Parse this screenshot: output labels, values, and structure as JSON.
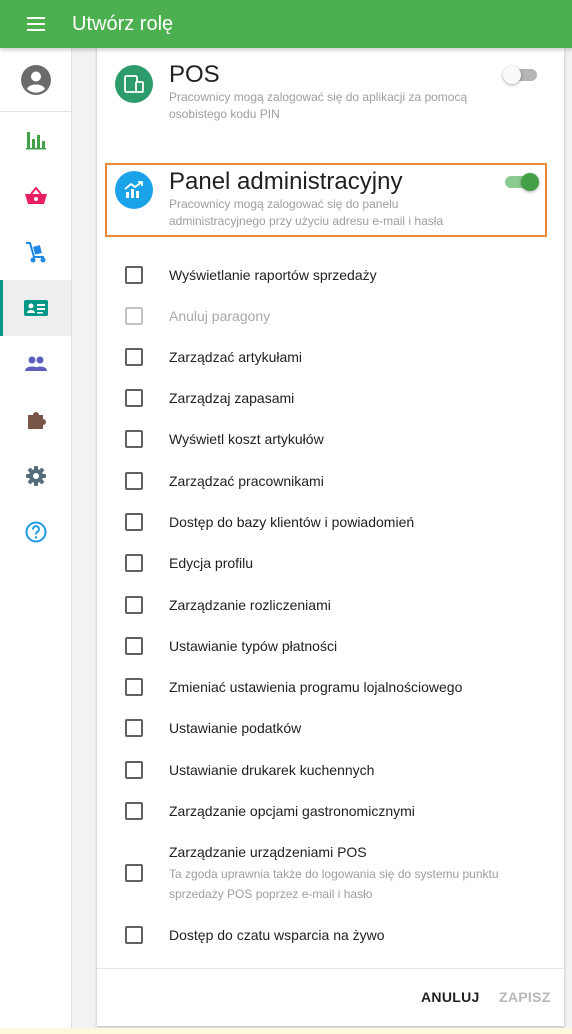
{
  "app": {
    "title": "Utwórz rolę"
  },
  "icons": {
    "menu": "menu-icon",
    "avatar": "account-circle-icon",
    "sidebar": [
      "bar-chart-icon",
      "basket-icon",
      "hand-truck-icon",
      "id-card-icon",
      "people-icon",
      "puzzle-icon",
      "gear-icon",
      "help-circle-icon"
    ]
  },
  "colors": {
    "accent": "#4caf50",
    "pos_icon": "#2e9c6a",
    "admin_icon": "#1aa3e8",
    "sidebar_active_indicator": "#009688",
    "highlight_border": "#e88a3a"
  },
  "pos": {
    "title": "POS",
    "description": "Pracownicy mogą zalogować się do aplikacji za pomocą osobistego kodu PIN",
    "enabled": false
  },
  "admin": {
    "title": "Panel administracyjny",
    "description": "Pracownicy mogą zalogować się do panelu administracyjnego przy użyciu adresu e-mail i hasła",
    "enabled": true
  },
  "permissions": [
    {
      "label": "Wyświetlanie raportów sprzedaży",
      "checked": false,
      "disabled": false
    },
    {
      "label": "Anuluj paragony",
      "checked": false,
      "disabled": true
    },
    {
      "label": "Zarządzać artykułami",
      "checked": false,
      "disabled": false
    },
    {
      "label": "Zarządzaj zapasami",
      "checked": false,
      "disabled": false
    },
    {
      "label": "Wyświetl koszt artykułów",
      "checked": false,
      "disabled": false
    },
    {
      "label": "Zarządzać pracownikami",
      "checked": false,
      "disabled": false
    },
    {
      "label": "Dostęp do bazy klientów i powiadomień",
      "checked": false,
      "disabled": false
    },
    {
      "label": "Edycja profilu",
      "checked": false,
      "disabled": false
    },
    {
      "label": "Zarządzanie rozliczeniami",
      "checked": false,
      "disabled": false
    },
    {
      "label": "Ustawianie typów płatności",
      "checked": false,
      "disabled": false
    },
    {
      "label": "Zmieniać ustawienia programu lojalnościowego",
      "checked": false,
      "disabled": false
    },
    {
      "label": "Ustawianie podatków",
      "checked": false,
      "disabled": false
    },
    {
      "label": "Ustawianie drukarek kuchennych",
      "checked": false,
      "disabled": false
    },
    {
      "label": "Zarządzanie opcjami gastronomicznymi",
      "checked": false,
      "disabled": false
    },
    {
      "label": "Zarządzanie urządzeniami POS",
      "description": "Ta zgoda uprawnia także do logowania się do systemu punktu sprzedaży POS poprzez e-mail i hasło",
      "checked": false,
      "disabled": false
    },
    {
      "label": "Dostęp do czatu wsparcia na żywo",
      "checked": false,
      "disabled": false
    }
  ],
  "actions": {
    "cancel": "ANULUJ",
    "save": "ZAPISZ"
  }
}
